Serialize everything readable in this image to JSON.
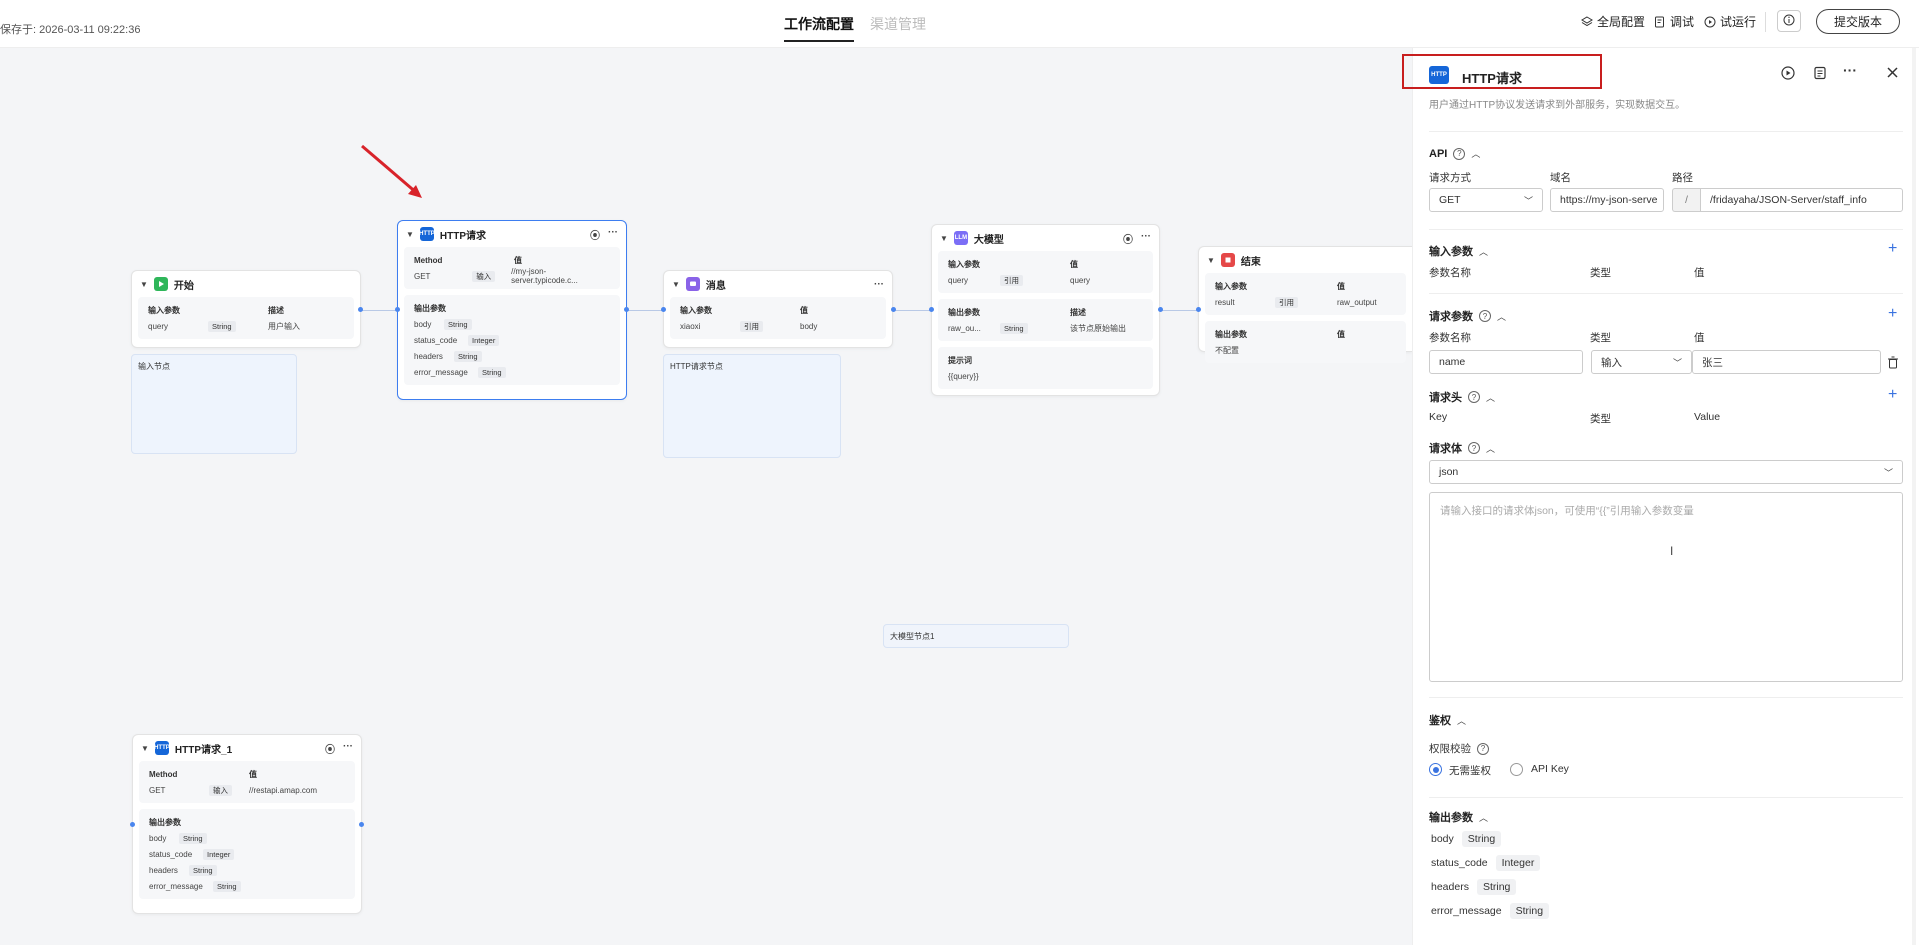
{
  "header": {
    "save_time": "保存于: 2026-03-11 09:22:36",
    "tabs": [
      "工作流配置",
      "渠道管理"
    ],
    "actions": [
      "全局配置",
      "调试",
      "试运行"
    ],
    "submit_label": "提交版本"
  },
  "canvas": {
    "nodes": {
      "start": {
        "title": "开始",
        "h1": "输入参数",
        "h2": "描述",
        "row": [
          "query",
          "String",
          "用户输入"
        ],
        "note": "输入节点"
      },
      "http": {
        "title": "HTTP请求",
        "method_h": "Method",
        "val_h": "值",
        "method_row": [
          "GET",
          "输入",
          "//my-json-server.typicode.c..."
        ],
        "out_h": "输出参数",
        "outputs": [
          [
            "body",
            "String"
          ],
          [
            "status_code",
            "Integer"
          ],
          [
            "headers",
            "String"
          ],
          [
            "error_message",
            "String"
          ]
        ]
      },
      "msg": {
        "title": "消息",
        "h1": "输入参数",
        "h2": "值",
        "row": [
          "xiaoxi",
          "引用",
          "body"
        ],
        "note": "HTTP请求节点"
      },
      "llm": {
        "title": "大模型",
        "in_h1": "输入参数",
        "in_h2": "值",
        "in_row": [
          "query",
          "引用",
          "query"
        ],
        "out_h1": "输出参数",
        "out_h2": "描述",
        "out_row": [
          "raw_ou...",
          "String",
          "该节点原始输出"
        ],
        "prompt_h": "提示词",
        "prompt": "{{query}}"
      },
      "end": {
        "title": "结束",
        "in_h1": "输入参数",
        "in_h2": "值",
        "in_row": [
          "result",
          "引用",
          "raw_output"
        ],
        "out_h1": "输出参数",
        "out_h2": "值",
        "out_row": "不配置"
      },
      "llm_note": "大模型节点1",
      "http1": {
        "title": "HTTP请求_1",
        "method_h": "Method",
        "val_h": "值",
        "method_row": [
          "GET",
          "输入",
          "//restapi.amap.com"
        ],
        "out_h": "输出参数",
        "outputs": [
          [
            "body",
            "String"
          ],
          [
            "status_code",
            "Integer"
          ],
          [
            "headers",
            "String"
          ],
          [
            "error_message",
            "String"
          ]
        ]
      }
    }
  },
  "panel": {
    "logo": "HTTP",
    "title": "HTTP请求",
    "desc": "用户通过HTTP协议发送请求到外部服务，实现数据交互。",
    "api_label": "API",
    "method_label": "请求方式",
    "domain_label": "域名",
    "path_label": "路径",
    "method_value": "GET",
    "domain_value": "https://my-json-serve",
    "slash": "/",
    "path_value": "/fridayaha/JSON-Server/staff_info",
    "input_params_label": "输入参数",
    "ip_cols": [
      "参数名称",
      "类型",
      "值"
    ],
    "req_params_label": "请求参数",
    "rp_cols": [
      "参数名称",
      "类型",
      "值"
    ],
    "rp_name": "name",
    "rp_type": "输入",
    "rp_value": "张三",
    "headers_label": "请求头",
    "h_cols": [
      "Key",
      "类型",
      "Value"
    ],
    "body_label": "请求体",
    "body_type": "json",
    "body_placeholder": "请输入接口的请求体json，可使用“{{”引用输入参数变量",
    "auth_label": "鉴权",
    "auth_check_label": "权限校验",
    "auth_opt1": "无需鉴权",
    "auth_opt2": "API Key",
    "outputs_label": "输出参数",
    "outputs": [
      {
        "name": "body",
        "type": "String"
      },
      {
        "name": "status_code",
        "type": "Integer"
      },
      {
        "name": "headers",
        "type": "String"
      },
      {
        "name": "error_message",
        "type": "String"
      }
    ]
  },
  "colors": {
    "accent": "#3a73e0",
    "highlight_box": "#c81e1e",
    "arrow": "#d8232a",
    "start_icon": "#2fb65a",
    "http_icon": "#1566d8",
    "msg_icon": "#8a63e8",
    "llm_icon": "#7b6ef6",
    "end_icon": "#e54848"
  }
}
